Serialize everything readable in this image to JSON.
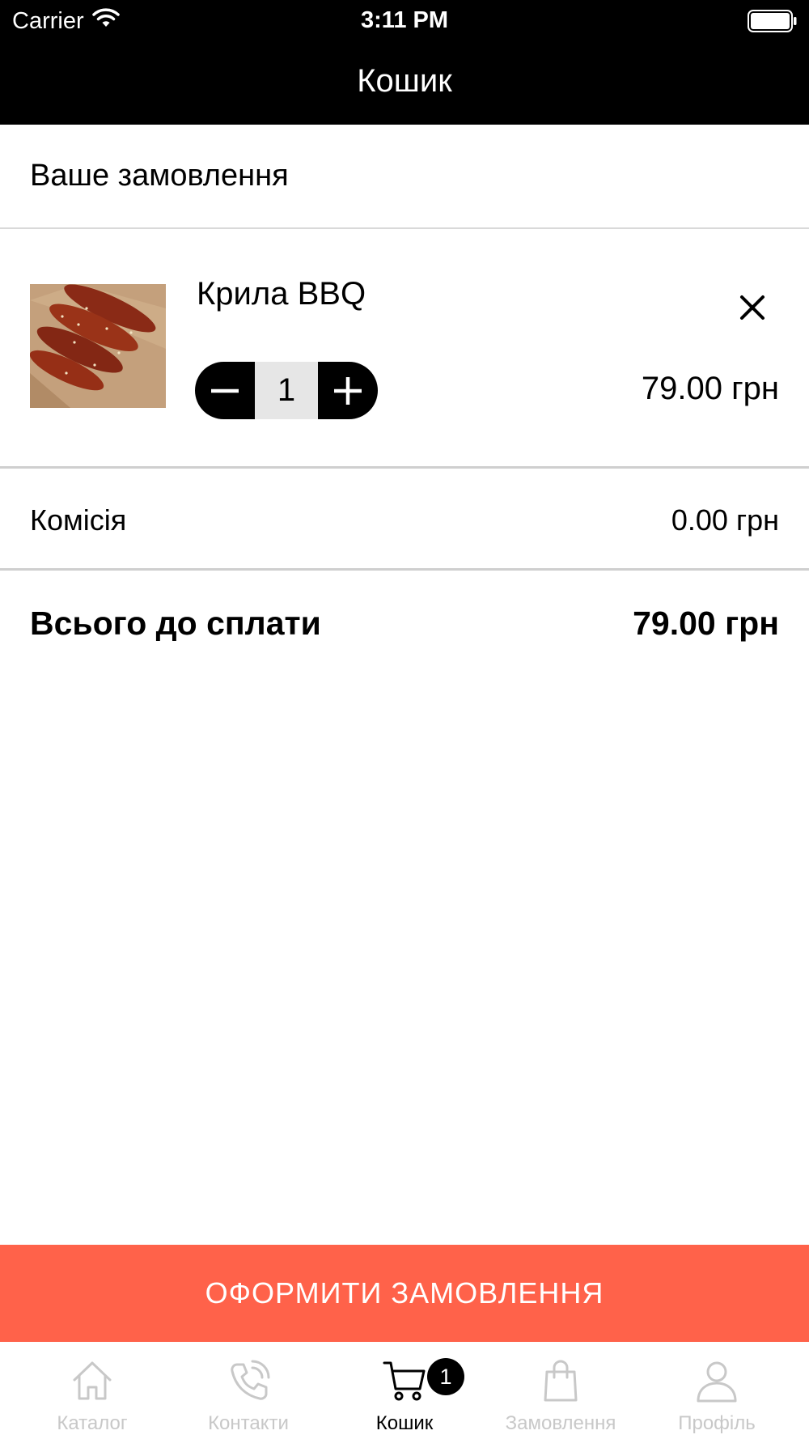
{
  "status_bar": {
    "carrier": "Carrier",
    "time": "3:11 PM"
  },
  "nav": {
    "title": "Кошик"
  },
  "section": {
    "title": "Ваше замовлення"
  },
  "cart_item": {
    "name": "Крила BBQ",
    "quantity": "1",
    "price": "79.00 грн",
    "image": "bbq-wings-photo"
  },
  "summary": {
    "commission_label": "Комісія",
    "commission_value": "0.00 грн",
    "total_label": "Всього до сплати",
    "total_value": "79.00 грн"
  },
  "checkout": {
    "label": "ОФОРМИТИ ЗАМОВЛЕННЯ",
    "color": "#ff624a"
  },
  "tabbar": {
    "tabs": [
      {
        "label": "Каталог",
        "icon": "home-icon",
        "active": false
      },
      {
        "label": "Контакти",
        "icon": "phone-icon",
        "active": false
      },
      {
        "label": "Кошик",
        "icon": "cart-icon",
        "active": true,
        "badge": "1"
      },
      {
        "label": "Замовлення",
        "icon": "bag-icon",
        "active": false
      },
      {
        "label": "Профіль",
        "icon": "profile-icon",
        "active": false
      }
    ]
  }
}
